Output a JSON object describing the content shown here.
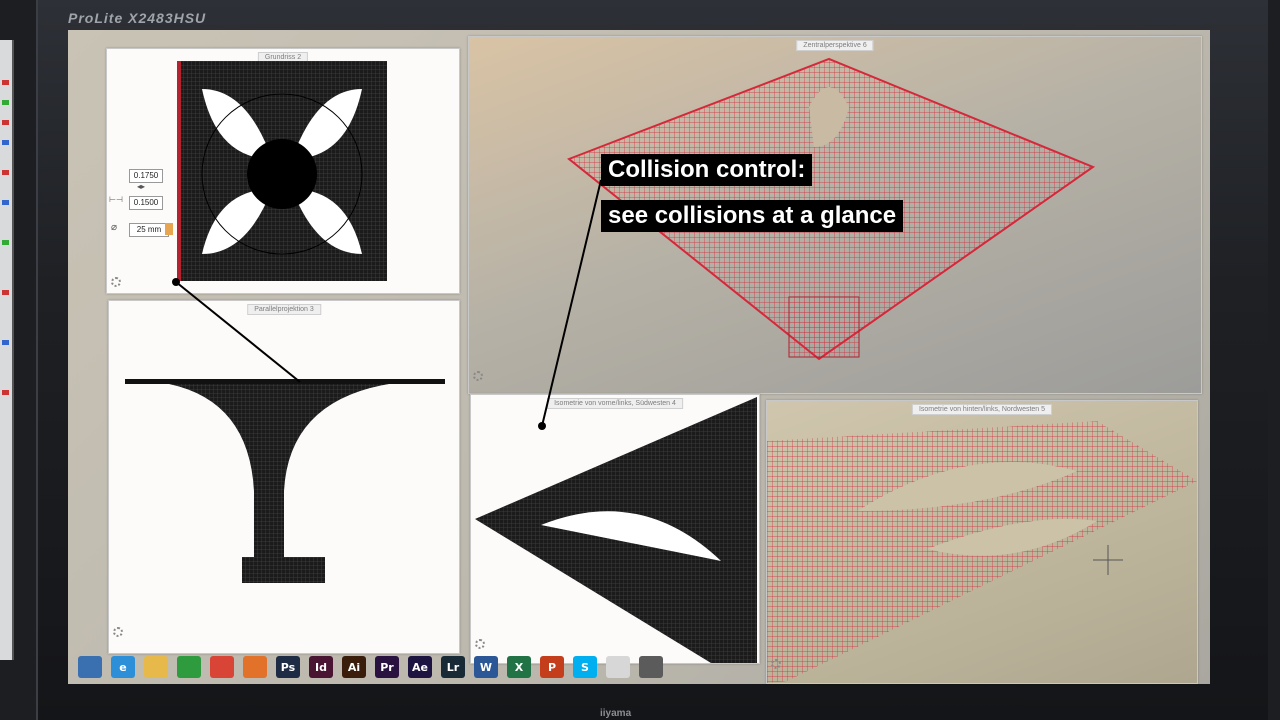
{
  "monitor": {
    "brand": "ProLite X2483HSU",
    "bottom_logo": "iiyama"
  },
  "panels": {
    "top_left": {
      "title": "Grundriss 2"
    },
    "bottom_left": {
      "title": "Parallelprojektion 3"
    },
    "top_right": {
      "title": "Zentralperspektive 6"
    },
    "bottom_middle": {
      "title": "Isometrie von vorne/links, Südwesten 4"
    },
    "bottom_right": {
      "title": "Isometrie von hinten/links, Nordwesten 5"
    }
  },
  "dimensions": {
    "value1": "0.1750",
    "value2": "0.1500",
    "diameter": "25 mm",
    "arrow_symbol": "◂▸",
    "width_symbol": "⊢⊣",
    "diameter_symbol": "⌀"
  },
  "callout": {
    "line1": "Collision control:",
    "line2": "see collisions at a glance"
  },
  "taskbar": {
    "items": [
      {
        "name": "windows-start",
        "label": "",
        "color": "#3a6fb0"
      },
      {
        "name": "internet-explorer",
        "label": "e",
        "color": "#2d8fd8"
      },
      {
        "name": "file-explorer",
        "label": "",
        "color": "#e6b94a"
      },
      {
        "name": "store",
        "label": "",
        "color": "#2e9b3e"
      },
      {
        "name": "chrome",
        "label": "",
        "color": "#d84436"
      },
      {
        "name": "firefox",
        "label": "",
        "color": "#e2712a"
      },
      {
        "name": "photoshop",
        "label": "Ps",
        "color": "#1d2b44"
      },
      {
        "name": "indesign",
        "label": "Id",
        "color": "#4a1433"
      },
      {
        "name": "illustrator",
        "label": "Ai",
        "color": "#3a1e0b"
      },
      {
        "name": "premiere",
        "label": "Pr",
        "color": "#2a1240"
      },
      {
        "name": "after-effects",
        "label": "Ae",
        "color": "#1e1442"
      },
      {
        "name": "lightroom",
        "label": "Lr",
        "color": "#182a36"
      },
      {
        "name": "word",
        "label": "W",
        "color": "#2b5797"
      },
      {
        "name": "excel",
        "label": "X",
        "color": "#217346"
      },
      {
        "name": "powerpoint",
        "label": "P",
        "color": "#c43e1c"
      },
      {
        "name": "skype",
        "label": "S",
        "color": "#00aff0"
      },
      {
        "name": "cad-app",
        "label": "",
        "color": "#d7d7d7"
      },
      {
        "name": "other-app",
        "label": "",
        "color": "#5b5b5b"
      }
    ]
  },
  "colors": {
    "mesh_black": "#111111",
    "mesh_red": "#d5283a",
    "callout_bg": "#000000"
  }
}
